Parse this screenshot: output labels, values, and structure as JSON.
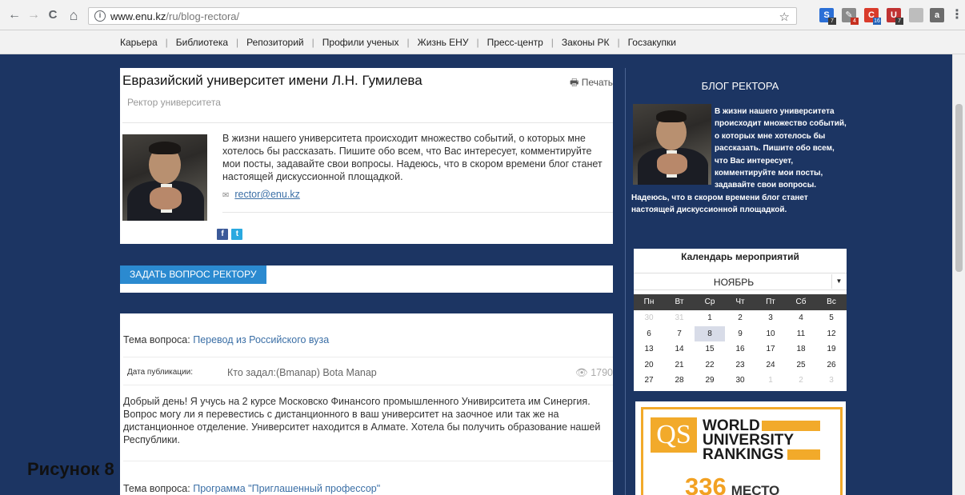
{
  "browser": {
    "back": "←",
    "forward": "→",
    "reload": "C",
    "home": "⌂",
    "info": "i",
    "url_host": "www.enu.kz",
    "url_path": "/ru/blog-rectora/",
    "bookmark": "☆",
    "extensions": [
      {
        "name": "ext-s-icon",
        "label": "S",
        "color": "#2b6fd6",
        "badge": "7",
        "badge_color": "#3b3b3b"
      },
      {
        "name": "ext-pen-icon",
        "label": "✎",
        "color": "#8a8a8a",
        "badge": "4",
        "badge_color": "#c62f1f"
      },
      {
        "name": "ext-g-icon",
        "label": "C",
        "color": "#d93b2b",
        "badge": "16",
        "badge_color": "#2463b8"
      },
      {
        "name": "ext-shield-icon",
        "label": "U",
        "color": "#c03232",
        "badge": "7",
        "badge_color": "#3b3b3b"
      },
      {
        "name": "ext-pdf-icon",
        "label": "",
        "color": "#bdbdbd",
        "badge": "",
        "badge_color": ""
      },
      {
        "name": "ext-bag-icon",
        "label": "a",
        "color": "#6c6c6c",
        "badge": "",
        "badge_color": ""
      }
    ],
    "menu": "⋮"
  },
  "site_nav": [
    "Карьера",
    "Библиотека",
    "Репозиторий",
    "Профили ученых",
    "Жизнь ЕНУ",
    "Пресс-центр",
    "Законы РК",
    "Госзакупки"
  ],
  "main": {
    "title": "Евразийский университет имени Л.Н. Гумилева",
    "print_label": "Печать",
    "subtitle": "Ректор университета",
    "intro": "В жизни нашего университета происходит множество событий, о которых мне хотелось бы рассказать. Пишите обо всем, что Вас интересует, комментируйте мои посты, задавайте свои вопросы. Надеюсь, что в скором времени блог станет настоящей дискуссионной площадкой.",
    "email": "rector@enu.kz",
    "ask_button": "ЗАДАТЬ ВОПРОС РЕКТОРУ"
  },
  "questions": [
    {
      "topic_label": "Тема вопроса:",
      "topic": "Перевод из Российского вуза",
      "date_label": "Дата публикации:",
      "asker": "Кто задал:(Bmanap) Bota Manap",
      "views": "1790",
      "body": "Добрый день! Я учусь на 2 курсе Московско Финансого промышленного Унивирситета им Синергия. Вопрос могу ли я перевестись с дистанционного в ваш университет на заочное или так же на дистанционное отделение. Университет находится в Алмате. Хотела бы получить образование нашей Республики."
    },
    {
      "topic_label": "Тема вопроса:",
      "topic": "Программа \"Приглашенный профессор\""
    }
  ],
  "caption": "Рисунок 8",
  "sidebar": {
    "blog_title": "БЛОГ РЕКТОРА",
    "blog_text": "В жизни нашего университета происходит множество событий, о которых мне хотелось бы рассказать. Пишите обо всем, что Вас интересует, комментируйте мои посты, задавайте свои вопросы. Надеюсь, что в скором времени блог станет настоящей дискуссионной площадкой.",
    "calendar": {
      "title": "Календарь мероприятий",
      "month": "НОЯБРЬ",
      "weekdays": [
        "Пн",
        "Вт",
        "Ср",
        "Чт",
        "Пт",
        "Сб",
        "Вс"
      ],
      "weeks": [
        [
          {
            "d": "30",
            "o": true
          },
          {
            "d": "31",
            "o": true
          },
          {
            "d": "1"
          },
          {
            "d": "2"
          },
          {
            "d": "3"
          },
          {
            "d": "4"
          },
          {
            "d": "5"
          }
        ],
        [
          {
            "d": "6"
          },
          {
            "d": "7"
          },
          {
            "d": "8",
            "today": true
          },
          {
            "d": "9"
          },
          {
            "d": "10"
          },
          {
            "d": "11"
          },
          {
            "d": "12"
          }
        ],
        [
          {
            "d": "13"
          },
          {
            "d": "14"
          },
          {
            "d": "15"
          },
          {
            "d": "16"
          },
          {
            "d": "17"
          },
          {
            "d": "18"
          },
          {
            "d": "19"
          }
        ],
        [
          {
            "d": "20"
          },
          {
            "d": "21"
          },
          {
            "d": "22"
          },
          {
            "d": "23"
          },
          {
            "d": "24"
          },
          {
            "d": "25"
          },
          {
            "d": "26"
          }
        ],
        [
          {
            "d": "27"
          },
          {
            "d": "28"
          },
          {
            "d": "29"
          },
          {
            "d": "30"
          },
          {
            "d": "1",
            "o": true
          },
          {
            "d": "2",
            "o": true
          },
          {
            "d": "3",
            "o": true
          }
        ]
      ]
    },
    "qs": {
      "logo": "QS",
      "line1": "WORLD",
      "line2": "UNIVERSITY",
      "line3": "RANKINGS",
      "rank": "336",
      "rank_unit": "МЕСТО"
    }
  },
  "colors": {
    "page_bg": "#1c3563",
    "accent_button": "#2b8ad0",
    "link": "#3b6fa6",
    "qs_orange": "#f2aa2a"
  }
}
